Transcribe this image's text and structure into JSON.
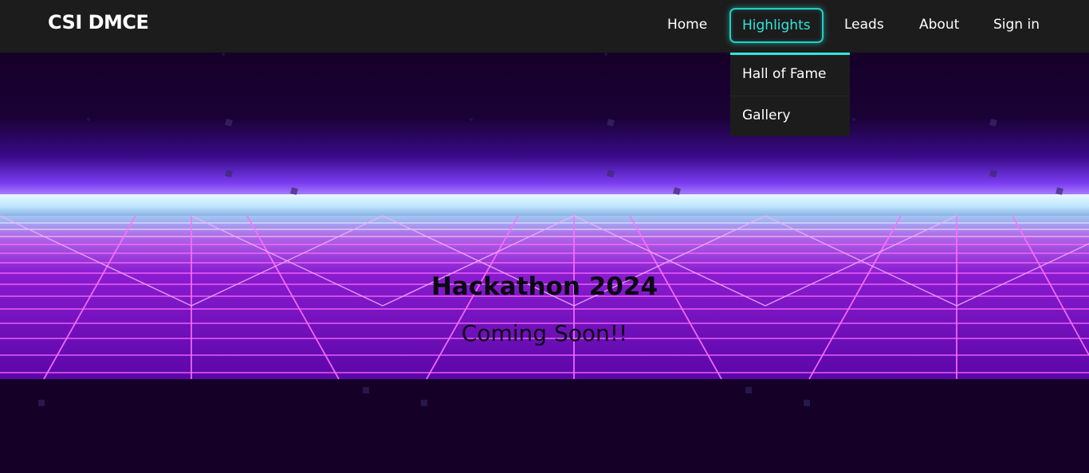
{
  "nav": {
    "brand": "CSI DMCE",
    "items": [
      {
        "label": "Home"
      },
      {
        "label": "Highlights"
      },
      {
        "label": "Leads"
      },
      {
        "label": "About"
      },
      {
        "label": "Sign in"
      }
    ],
    "active_item": "Highlights",
    "dropdown": [
      {
        "label": "Hall of Fame"
      },
      {
        "label": "Gallery"
      }
    ]
  },
  "hero": {
    "title": "Hackathon 2024",
    "subtitle": "Coming Soon!!"
  },
  "colors": {
    "navbar_bg": "#1c1c1c",
    "accent": "#2fe7de",
    "page_bg": "#150028",
    "grid_line": "#e040ff",
    "horizon_glow": "#cfeeff"
  }
}
